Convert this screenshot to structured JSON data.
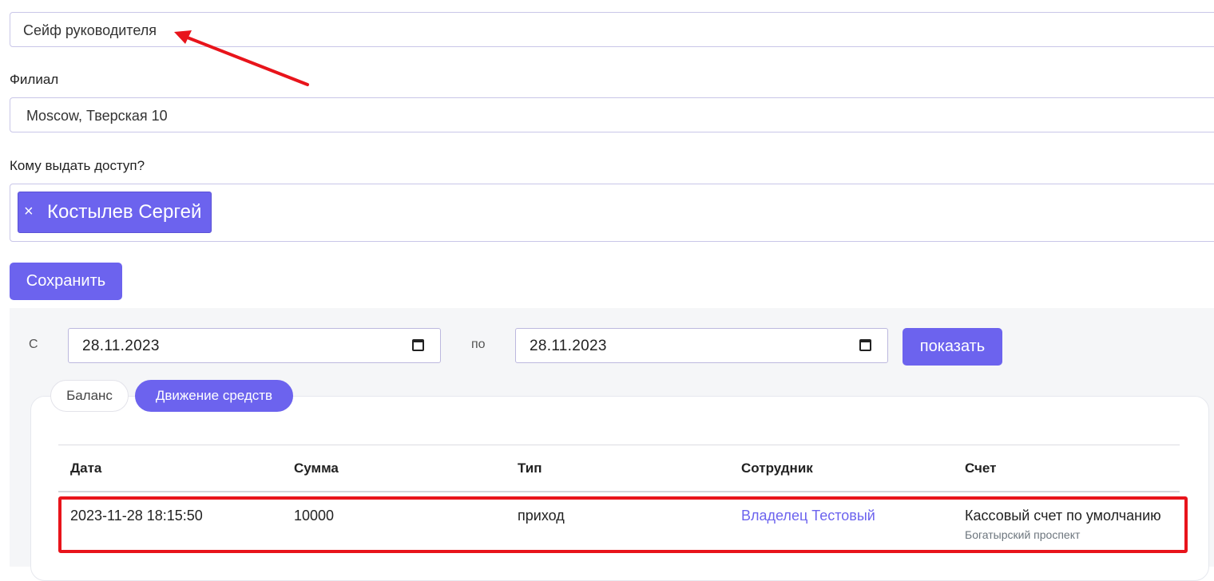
{
  "safe": {
    "name_value": "Сейф руководителя"
  },
  "branch": {
    "label": "Филиал",
    "value": "Moscow, Тверская 10"
  },
  "access": {
    "label": "Кому выдать доступ?",
    "chip_remove": "×",
    "chip_name": "Костылев Сергей"
  },
  "save_label": "Сохранить",
  "filter": {
    "from_label": "С",
    "from_value": "28.11.2023",
    "to_label": "по",
    "to_value": "28.11.2023",
    "show_label": "показать"
  },
  "tabs": [
    {
      "label": "Баланс",
      "active": false
    },
    {
      "label": "Движение средств",
      "active": true
    }
  ],
  "table": {
    "headers": [
      "Дата",
      "Сумма",
      "Тип",
      "Сотрудник",
      "Счет"
    ],
    "rows": [
      {
        "date": "2023-11-28 18:15:50",
        "amount": "10000",
        "type": "приход",
        "employee": "Владелец Тестовый",
        "account": "Кассовый счет по умолчанию",
        "account_sub": "Богатырский проспект"
      }
    ]
  },
  "colors": {
    "accent": "#6c63ee",
    "annotation": "#e8141b"
  }
}
